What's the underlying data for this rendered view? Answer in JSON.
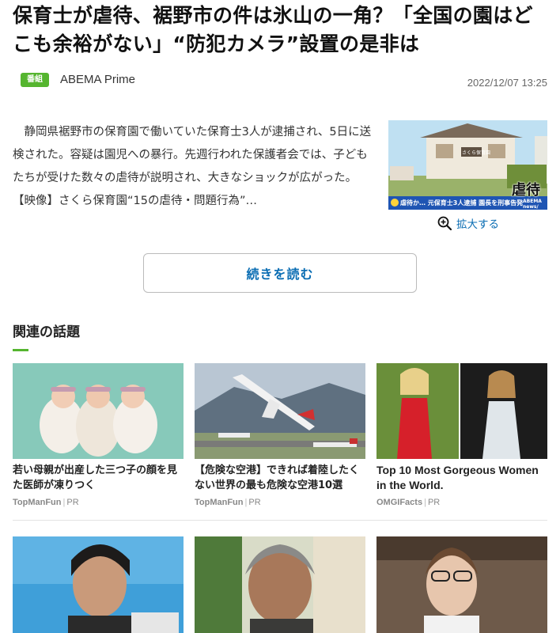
{
  "headline": "保育士が虐待、裾野市の件は氷山の一角？「全国の園はどこも余裕がない」“防犯カメラ”設置の是非は",
  "badge": "番組",
  "source": "ABEMA Prime",
  "date": "2022/12/07 13:25",
  "body_text": "静岡県裾野市の保育園で働いていた保育士3人が逮捕され、5日に送検された。容疑は園児への暴行。先週行われた保護者会では、子どもたちが受けた数々の虐待が説明され、大きなショックが広がった。",
  "body_link": "【映像】さくら保育園“15の虐待・問題行為”…",
  "thumb": {
    "sign_text": "さくら保育園",
    "caption_big": "虐待",
    "caption_bar": "虐待か… 元保育士3人逮捕 園長を刑事告発",
    "logo": "ABEMA news/"
  },
  "zoom_label": "拡大する",
  "read_more": "続きを読む",
  "related_title": "関連の話題",
  "cards": [
    {
      "title": "若い母親が出産した三つ子の顔を見た医師が凍りつく",
      "sponsor": "TopManFun",
      "pr": "PR"
    },
    {
      "title": "【危険な空港】できれば着陸したくない世界の最も危険な空港10選",
      "sponsor": "TopManFun",
      "pr": "PR"
    },
    {
      "title": "Top 10 Most Gorgeous Women in the World.",
      "sponsor": "OMGIFacts",
      "pr": "PR"
    }
  ],
  "colors": {
    "accent": "#55b52f",
    "link": "#0a6db3"
  }
}
